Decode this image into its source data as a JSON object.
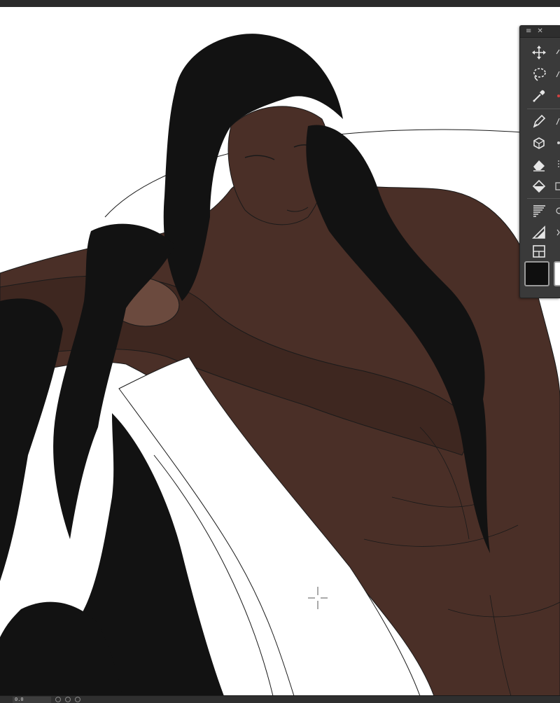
{
  "window": {
    "title_bar_color": "#2b2b2b"
  },
  "palette": {
    "menu_icon": "hamburger-icon",
    "close_icon": "close-icon",
    "menu_glyph": "≡",
    "close_glyph": "✕",
    "tools": [
      {
        "name": "move-tool",
        "icon": "move-icon"
      },
      {
        "name": "lasso-tool",
        "icon": "lasso-icon"
      },
      {
        "name": "eyedropper-tool",
        "icon": "eyedropper-icon"
      },
      {
        "name": "pen-tool",
        "icon": "pen-nib-icon"
      },
      {
        "name": "blend-tool",
        "icon": "blend-icon"
      },
      {
        "name": "eraser-tool",
        "icon": "eraser-icon"
      },
      {
        "name": "fill-tool",
        "icon": "fill-bucket-icon"
      },
      {
        "name": "gradient-tool",
        "icon": "gradient-icon"
      },
      {
        "name": "figure-tool",
        "icon": "figure-icon"
      },
      {
        "name": "frame-tool",
        "icon": "frame-icon"
      }
    ],
    "main_color": "#0f0f0f",
    "sub_color": "#ffffff"
  },
  "status": {
    "zoom_text": "0.0"
  },
  "colors": {
    "skin": "#4a2f27",
    "skin_dark": "#3e2720",
    "skin_light": "#6b4a3e",
    "hair": "#121212",
    "line": "#1a1a1a",
    "panel": "#3a3a3a",
    "icon": "#e6e6e6"
  }
}
